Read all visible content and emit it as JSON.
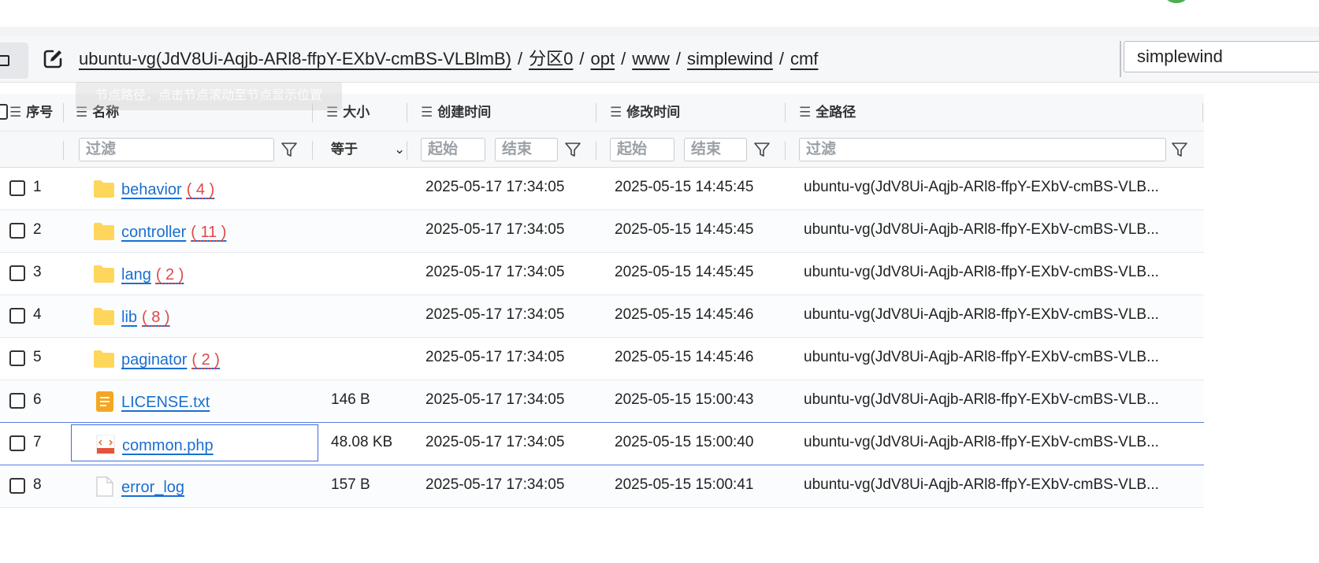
{
  "breadcrumb": {
    "segments": [
      "ubuntu-vg(JdV8Ui-Aqjb-ARl8-ffpY-EXbV-cmBS-VLBlmB)",
      "分区0",
      "opt",
      "www",
      "simplewind",
      "cmf"
    ],
    "separator": "/"
  },
  "search": {
    "value": "simplewind"
  },
  "tooltip": {
    "text": "节点路径，点击节点滚动至节点显示位置"
  },
  "columns": {
    "index": "序号",
    "name": "名称",
    "size": "大小",
    "created": "创建时间",
    "modified": "修改时间",
    "fullpath": "全路径"
  },
  "filters": {
    "name_placeholder": "过滤",
    "size_op": "等于",
    "start_placeholder": "起始",
    "end_placeholder": "结束",
    "path_placeholder": "过滤"
  },
  "rows": [
    {
      "index": "1",
      "name": "behavior",
      "count": "( 4 )",
      "size": "",
      "created": "2025-05-17 17:34:05",
      "modified": "2025-05-15 14:45:45",
      "path": "ubuntu-vg(JdV8Ui-Aqjb-ARl8-ffpY-EXbV-cmBS-VLB...",
      "type": "folder"
    },
    {
      "index": "2",
      "name": "controller",
      "count": "( 11 )",
      "size": "",
      "created": "2025-05-17 17:34:05",
      "modified": "2025-05-15 14:45:45",
      "path": "ubuntu-vg(JdV8Ui-Aqjb-ARl8-ffpY-EXbV-cmBS-VLB...",
      "type": "folder"
    },
    {
      "index": "3",
      "name": "lang",
      "count": "( 2 )",
      "size": "",
      "created": "2025-05-17 17:34:05",
      "modified": "2025-05-15 14:45:45",
      "path": "ubuntu-vg(JdV8Ui-Aqjb-ARl8-ffpY-EXbV-cmBS-VLB...",
      "type": "folder"
    },
    {
      "index": "4",
      "name": "lib",
      "count": "( 8 )",
      "size": "",
      "created": "2025-05-17 17:34:05",
      "modified": "2025-05-15 14:45:46",
      "path": "ubuntu-vg(JdV8Ui-Aqjb-ARl8-ffpY-EXbV-cmBS-VLB...",
      "type": "folder"
    },
    {
      "index": "5",
      "name": "paginator",
      "count": "( 2 )",
      "size": "",
      "created": "2025-05-17 17:34:05",
      "modified": "2025-05-15 14:45:46",
      "path": "ubuntu-vg(JdV8Ui-Aqjb-ARl8-ffpY-EXbV-cmBS-VLB...",
      "type": "folder"
    },
    {
      "index": "6",
      "name": "LICENSE.txt",
      "count": "",
      "size": "146 B",
      "created": "2025-05-17 17:34:05",
      "modified": "2025-05-15 15:00:43",
      "path": "ubuntu-vg(JdV8Ui-Aqjb-ARl8-ffpY-EXbV-cmBS-VLB...",
      "type": "text"
    },
    {
      "index": "7",
      "name": "common.php",
      "count": "",
      "size": "48.08 KB",
      "created": "2025-05-17 17:34:05",
      "modified": "2025-05-15 15:00:40",
      "path": "ubuntu-vg(JdV8Ui-Aqjb-ARl8-ffpY-EXbV-cmBS-VLB...",
      "type": "code"
    },
    {
      "index": "8",
      "name": "error_log",
      "count": "",
      "size": "157 B",
      "created": "2025-05-17 17:34:05",
      "modified": "2025-05-15 15:00:41",
      "path": "ubuntu-vg(JdV8Ui-Aqjb-ARl8-ffpY-EXbV-cmBS-VLB...",
      "type": "file"
    }
  ],
  "icons": {
    "folder": "folder-icon",
    "text": "text-file-icon",
    "code": "html-file-icon",
    "file": "blank-file-icon"
  },
  "colors": {
    "link": "#1a6fd1",
    "count": "#e04848",
    "folder": "#ffd65c",
    "text_file": "#f5a623",
    "selection": "#5b7be6"
  }
}
